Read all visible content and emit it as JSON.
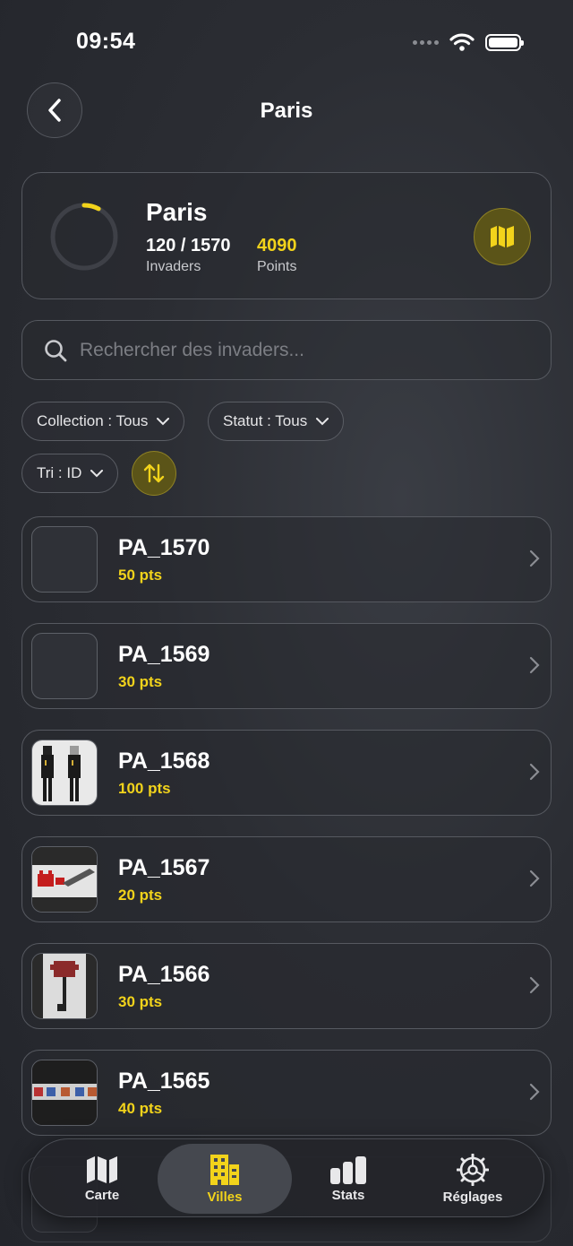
{
  "status_bar": {
    "time": "09:54"
  },
  "header": {
    "title": "Paris"
  },
  "city": {
    "name": "Paris",
    "found": "120 / 1570",
    "found_label": "Invaders",
    "points": "4090",
    "points_label": "Points",
    "progress": 0.076
  },
  "search": {
    "placeholder": "Rechercher des invaders..."
  },
  "filters": {
    "collection": "Collection : Tous",
    "status": "Statut : Tous",
    "sort": "Tri : ID"
  },
  "invaders": [
    {
      "id": "PA_1570",
      "points": "50 pts"
    },
    {
      "id": "PA_1569",
      "points": "30 pts"
    },
    {
      "id": "PA_1568",
      "points": "100 pts"
    },
    {
      "id": "PA_1567",
      "points": "20 pts"
    },
    {
      "id": "PA_1566",
      "points": "30 pts"
    },
    {
      "id": "PA_1565",
      "points": "40 pts"
    }
  ],
  "tabs": [
    {
      "label": "Carte",
      "icon": "map-icon"
    },
    {
      "label": "Villes",
      "icon": "buildings-icon"
    },
    {
      "label": "Stats",
      "icon": "bar-chart-icon"
    },
    {
      "label": "Réglages",
      "icon": "gear-icon"
    }
  ],
  "colors": {
    "accent": "#f2d31b",
    "background": "#2b2d33"
  }
}
